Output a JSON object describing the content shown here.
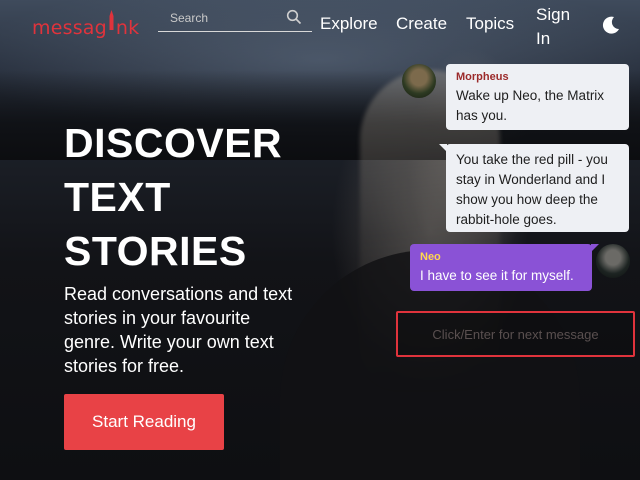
{
  "header": {
    "logo_text": "messagink",
    "search": {
      "placeholder": "Search"
    },
    "nav": {
      "explore": "Explore",
      "create": "Create",
      "topics": "Topics",
      "sign_in": "Sign In"
    }
  },
  "hero": {
    "title_lines": [
      "DISCOVER",
      "TEXT",
      "STORIES"
    ],
    "subtitle": "Read conversations and text stories in your favourite genre. Write your own text stories for free.",
    "cta": "Start Reading"
  },
  "chat": {
    "messages": [
      {
        "sender": "Morpheus",
        "text": "Wake up Neo, the Matrix has you."
      },
      {
        "sender": "",
        "text": "You take the red pill - you stay in Wonderland and I show you how deep the rabbit-hole goes."
      },
      {
        "sender": "Neo",
        "text": "I have to see it for myself."
      }
    ],
    "next_prompt": "Click/Enter for next message"
  },
  "colors": {
    "brand": "#e0333c",
    "cta": "#e84246",
    "neo_bubble": "#8a52d6",
    "bubble": "#eef0f4"
  },
  "icons": [
    "search-icon",
    "moon-icon",
    "pen-icon"
  ]
}
